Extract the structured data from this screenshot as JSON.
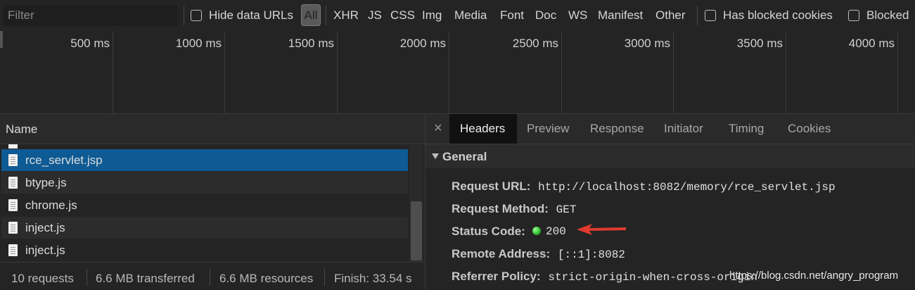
{
  "filterbar": {
    "placeholder": "Filter",
    "hide_data_urls": "Hide data URLs",
    "types": [
      "All",
      "XHR",
      "JS",
      "CSS",
      "Img",
      "Media",
      "Font",
      "Doc",
      "WS",
      "Manifest",
      "Other"
    ],
    "has_blocked_cookies": "Has blocked cookies",
    "blocked": "Blocked"
  },
  "timeline": {
    "ticks": [
      "500 ms",
      "1000 ms",
      "1500 ms",
      "2000 ms",
      "2500 ms",
      "3000 ms",
      "3500 ms",
      "4000 ms"
    ]
  },
  "list": {
    "header": "Name",
    "rows": [
      "rce_servlet.jsp",
      "btype.js",
      "chrome.js",
      "inject.js",
      "inject.js"
    ],
    "selected_row": "rce_servlet.jsp"
  },
  "status": {
    "requests": "10 requests",
    "transferred": "6.6 MB transferred",
    "resources": "6.6 MB resources",
    "finish": "Finish: 33.54 s"
  },
  "details": {
    "close_symbol": "×",
    "tabs": [
      "Headers",
      "Preview",
      "Response",
      "Initiator",
      "Timing",
      "Cookies"
    ],
    "active_tab": "Headers",
    "section_title": "General",
    "headers": [
      {
        "key": "Request URL:",
        "value": "http://localhost:8082/memory/rce_servlet.jsp"
      },
      {
        "key": "Request Method:",
        "value": "GET"
      },
      {
        "key": "Status Code:",
        "value": "200"
      },
      {
        "key": "Remote Address:",
        "value": "[::1]:8082"
      },
      {
        "key": "Referrer Policy:",
        "value": "strict-origin-when-cross-origin"
      }
    ]
  },
  "colors": {
    "selected_row": "#0e5a94",
    "status_ok": "#2fbf2f",
    "annotation_arrow": "#e03a2f"
  },
  "watermark": "https://blog.csdn.net/angry_program"
}
